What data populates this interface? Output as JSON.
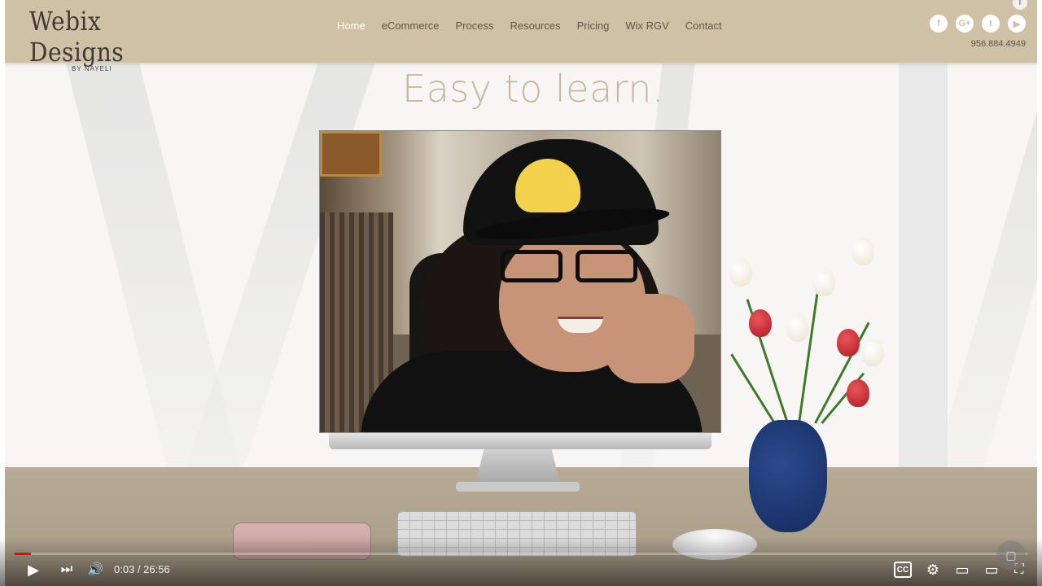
{
  "site": {
    "logo_text": "Webix Designs",
    "logo_sub": "BY NAYELI",
    "nav": [
      {
        "label": "Home",
        "active": true
      },
      {
        "label": "eCommerce",
        "active": false
      },
      {
        "label": "Process",
        "active": false
      },
      {
        "label": "Resources",
        "active": false
      },
      {
        "label": "Pricing",
        "active": false
      },
      {
        "label": "Wix RGV",
        "active": false
      },
      {
        "label": "Contact",
        "active": false
      }
    ],
    "social": [
      {
        "icon": "facebook-icon",
        "glyph": "f"
      },
      {
        "icon": "google-plus-icon",
        "glyph": "G+"
      },
      {
        "icon": "twitter-icon",
        "glyph": "t"
      },
      {
        "icon": "youtube-icon",
        "glyph": "▶"
      }
    ],
    "phone": "956.884.4949",
    "headline": "Easy to learn.",
    "colors": {
      "header": "#cfc1a5",
      "headline": "#c6b89a",
      "nav_active": "#ffffff"
    }
  },
  "player": {
    "time_current": "0:03",
    "time_separator": " / ",
    "time_total": "26:56",
    "progress_fraction": 0.002,
    "icons": {
      "play": "▶",
      "next": "⏭",
      "volume": "🔊",
      "captions": "CC",
      "settings": "⚙",
      "miniplayer": "▭",
      "theater": "▭",
      "fullscreen": "⛶"
    },
    "accent": "#ff0000"
  }
}
